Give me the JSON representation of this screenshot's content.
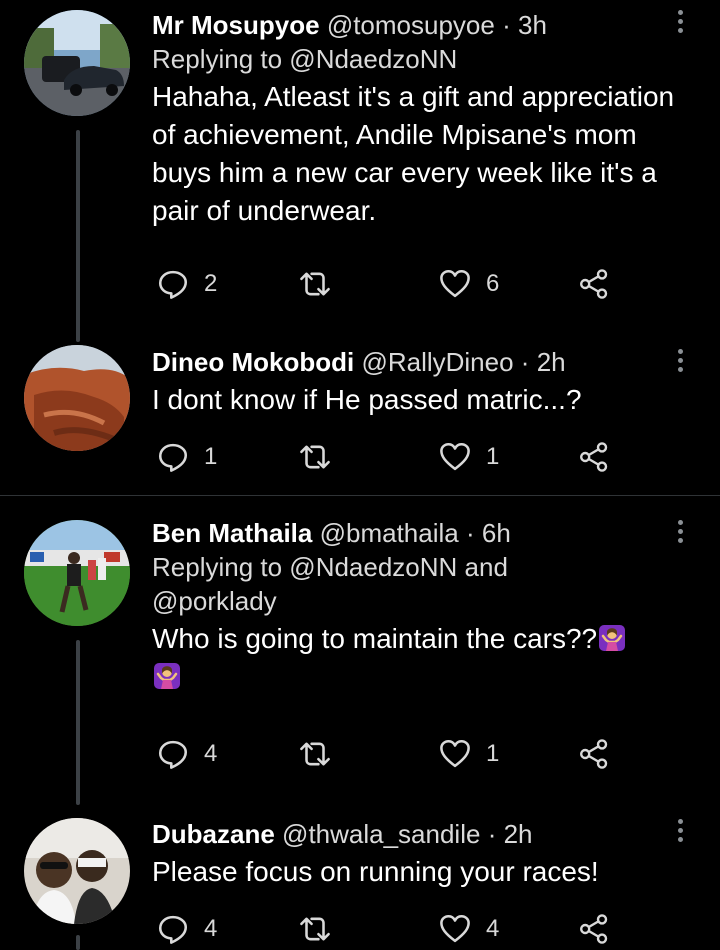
{
  "tweets": [
    {
      "name": "Mr Mosupyoe",
      "handle": "@tomosupyoe",
      "dot": "·",
      "time": "3h",
      "replying": "Replying to @NdaedzoNN",
      "text": "Hahaha, Atleast it's a gift and appreciation of achievement, Andile Mpisane's mom buys him a new car every week like it's a pair of underwear.",
      "replies": "2",
      "retweets": "",
      "likes": "6"
    },
    {
      "name": "Dineo Mokobodi",
      "handle": "@RallyDineo",
      "dot": "·",
      "time": "2h",
      "text": "I dont know if He passed matric...?",
      "replies": "1",
      "retweets": "",
      "likes": "1"
    },
    {
      "name": "Ben Mathaila",
      "handle": "@bmathaila",
      "dot": "·",
      "time": "6h",
      "replying_line1": "Replying to @NdaedzoNN and",
      "replying_line2": "@porklady",
      "text": "Who is going to maintain the cars??",
      "replies": "4",
      "retweets": "",
      "likes": "1"
    },
    {
      "name": "Dubazane",
      "handle": "@thwala_sandile",
      "dot": "·",
      "time": "2h",
      "text": "Please focus on running your races!",
      "replies": "4",
      "retweets": "",
      "likes": "4"
    }
  ],
  "icons": {
    "reply": "reply-icon",
    "retweet": "retweet-icon",
    "like": "heart-icon",
    "share": "share-icon",
    "more": "more-options-icon",
    "emoji": "person-shrugging-emoji"
  },
  "colors": {
    "background": "#000000",
    "secondary_text": "#dadada",
    "icon": "#d9d9d9",
    "thread_line": "#3c4146"
  }
}
